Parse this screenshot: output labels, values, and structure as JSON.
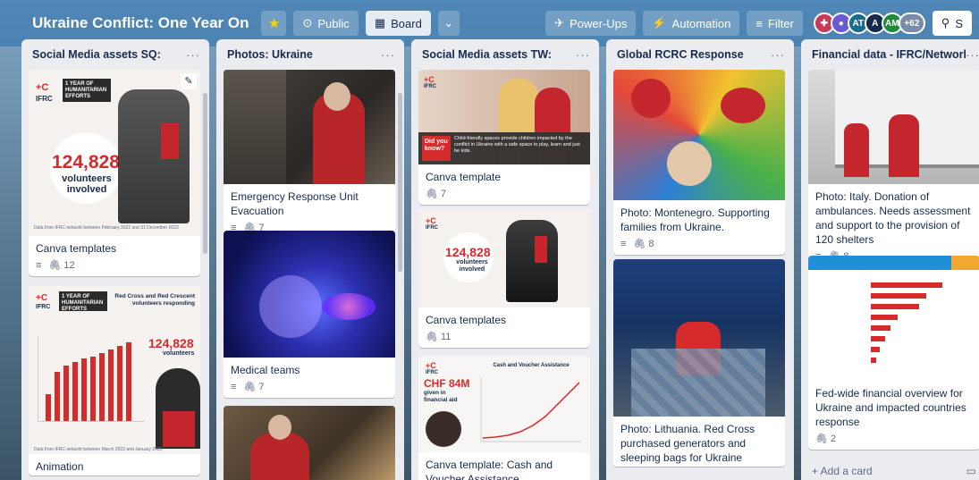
{
  "header": {
    "board_title": "Ukraine Conflict: One Year On",
    "visibility": "Public",
    "view": "Board",
    "powerups": "Power-Ups",
    "automation": "Automation",
    "filter": "Filter",
    "member_more": "+62",
    "share": "S",
    "members": [
      {
        "initials": "AT",
        "color": "#1a6b8c"
      },
      {
        "initials": "A",
        "color": "#172b4d"
      },
      {
        "initials": "AM",
        "color": "#1f8a3a"
      }
    ]
  },
  "lists": [
    {
      "title": "Social Media assets SQ:",
      "cards": [
        {
          "title": "Canva templates",
          "attachments": "12",
          "cover": {
            "brand": "IFRC",
            "headline": "1 YEAR OF HUMANITARIAN EFFORTS",
            "number": "124,828",
            "caption": "volunteers involved",
            "note": "Data from IFRC network between February 2022 and 31 December 2022"
          }
        },
        {
          "title": "Animation",
          "cover": {
            "brand": "IFRC",
            "headline": "1 YEAR OF HUMANITARIAN EFFORTS",
            "subtitle": "Red Cross and Red Crescent volunteers responding",
            "number": "124,828",
            "caption": "volunteers",
            "note": "Data from IFRC network between March 2022 and January 2023"
          }
        }
      ]
    },
    {
      "title": "Photos: Ukraine",
      "cards": [
        {
          "title": "Emergency Response Unit Evacuation",
          "attachments": "7"
        },
        {
          "title": "Medical teams",
          "attachments": "7"
        },
        {
          "title": ""
        }
      ]
    },
    {
      "title": "Social Media assets TW:",
      "cards": [
        {
          "title": "Canva template",
          "attachments": "7",
          "cover": {
            "brand": "IFRC",
            "tag": "Did you know?",
            "caption": "Child-friendly spaces provide children impacted by the conflict in Ukraine with a safe space to play, learn and just be kids."
          }
        },
        {
          "title": "Canva templates",
          "attachments": "11",
          "cover": {
            "brand": "IFRC",
            "number": "124,828",
            "caption": "volunteers involved"
          }
        },
        {
          "title": "Canva template: Cash and Voucher Assistance",
          "cover": {
            "brand": "IFRC",
            "number": "CHF 84M",
            "caption": "given in financial aid",
            "chart_title": "Cash and Voucher Assistance"
          }
        }
      ]
    },
    {
      "title": "Global RCRC Response",
      "cards": [
        {
          "title": "Photo: Montenegro. Supporting families from Ukraine.",
          "attachments": "8"
        },
        {
          "title": "Photo: Lithuania. Red Cross purchased generators and sleeping bags for Ukraine"
        }
      ]
    },
    {
      "title": "Financial data - IFRC/Network",
      "cards": [
        {
          "title": "Photo: Italy. Donation of ambulances. Needs assessment and support to the provision of 120 shelters",
          "attachments": "8"
        },
        {
          "title": "Fed-wide financial overview for Ukraine and impacted countries response",
          "attachments": "2"
        }
      ],
      "add_card": "+ Add a card"
    }
  ]
}
